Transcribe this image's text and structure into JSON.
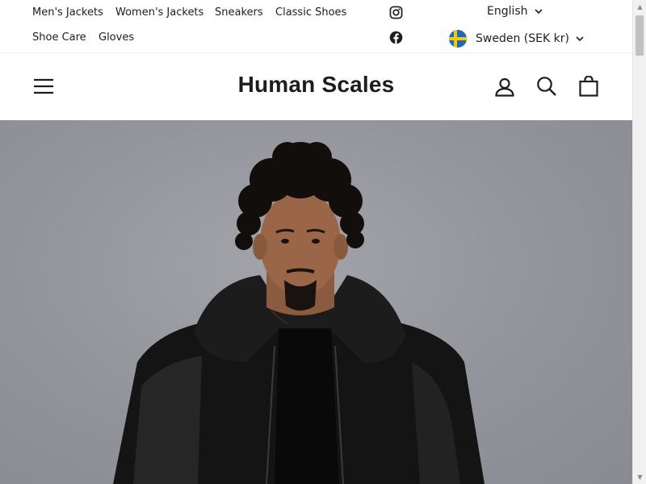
{
  "utility_nav": {
    "row1": [
      "Men's Jackets",
      "Women's Jackets",
      "Sneakers",
      "Classic Shoes"
    ],
    "row2": [
      "Shoe Care",
      "Gloves"
    ]
  },
  "social": {
    "instagram_icon": "instagram-icon",
    "facebook_icon": "facebook-icon"
  },
  "language_selector": {
    "value": "English"
  },
  "currency_selector": {
    "value": "Sweden (SEK kr)",
    "flag": "sweden-flag"
  },
  "header": {
    "logo": "Human Scales",
    "icons": [
      "hamburger-menu-icon",
      "account-icon",
      "search-icon",
      "cart-icon"
    ]
  },
  "hero": {
    "subject": "man-in-black-leather-jacket-photo"
  },
  "colors": {
    "text": "#1c1d1d",
    "hero_bg": "#93939b",
    "flag_blue": "#1d6bb6",
    "flag_yellow": "#f6c90e"
  }
}
